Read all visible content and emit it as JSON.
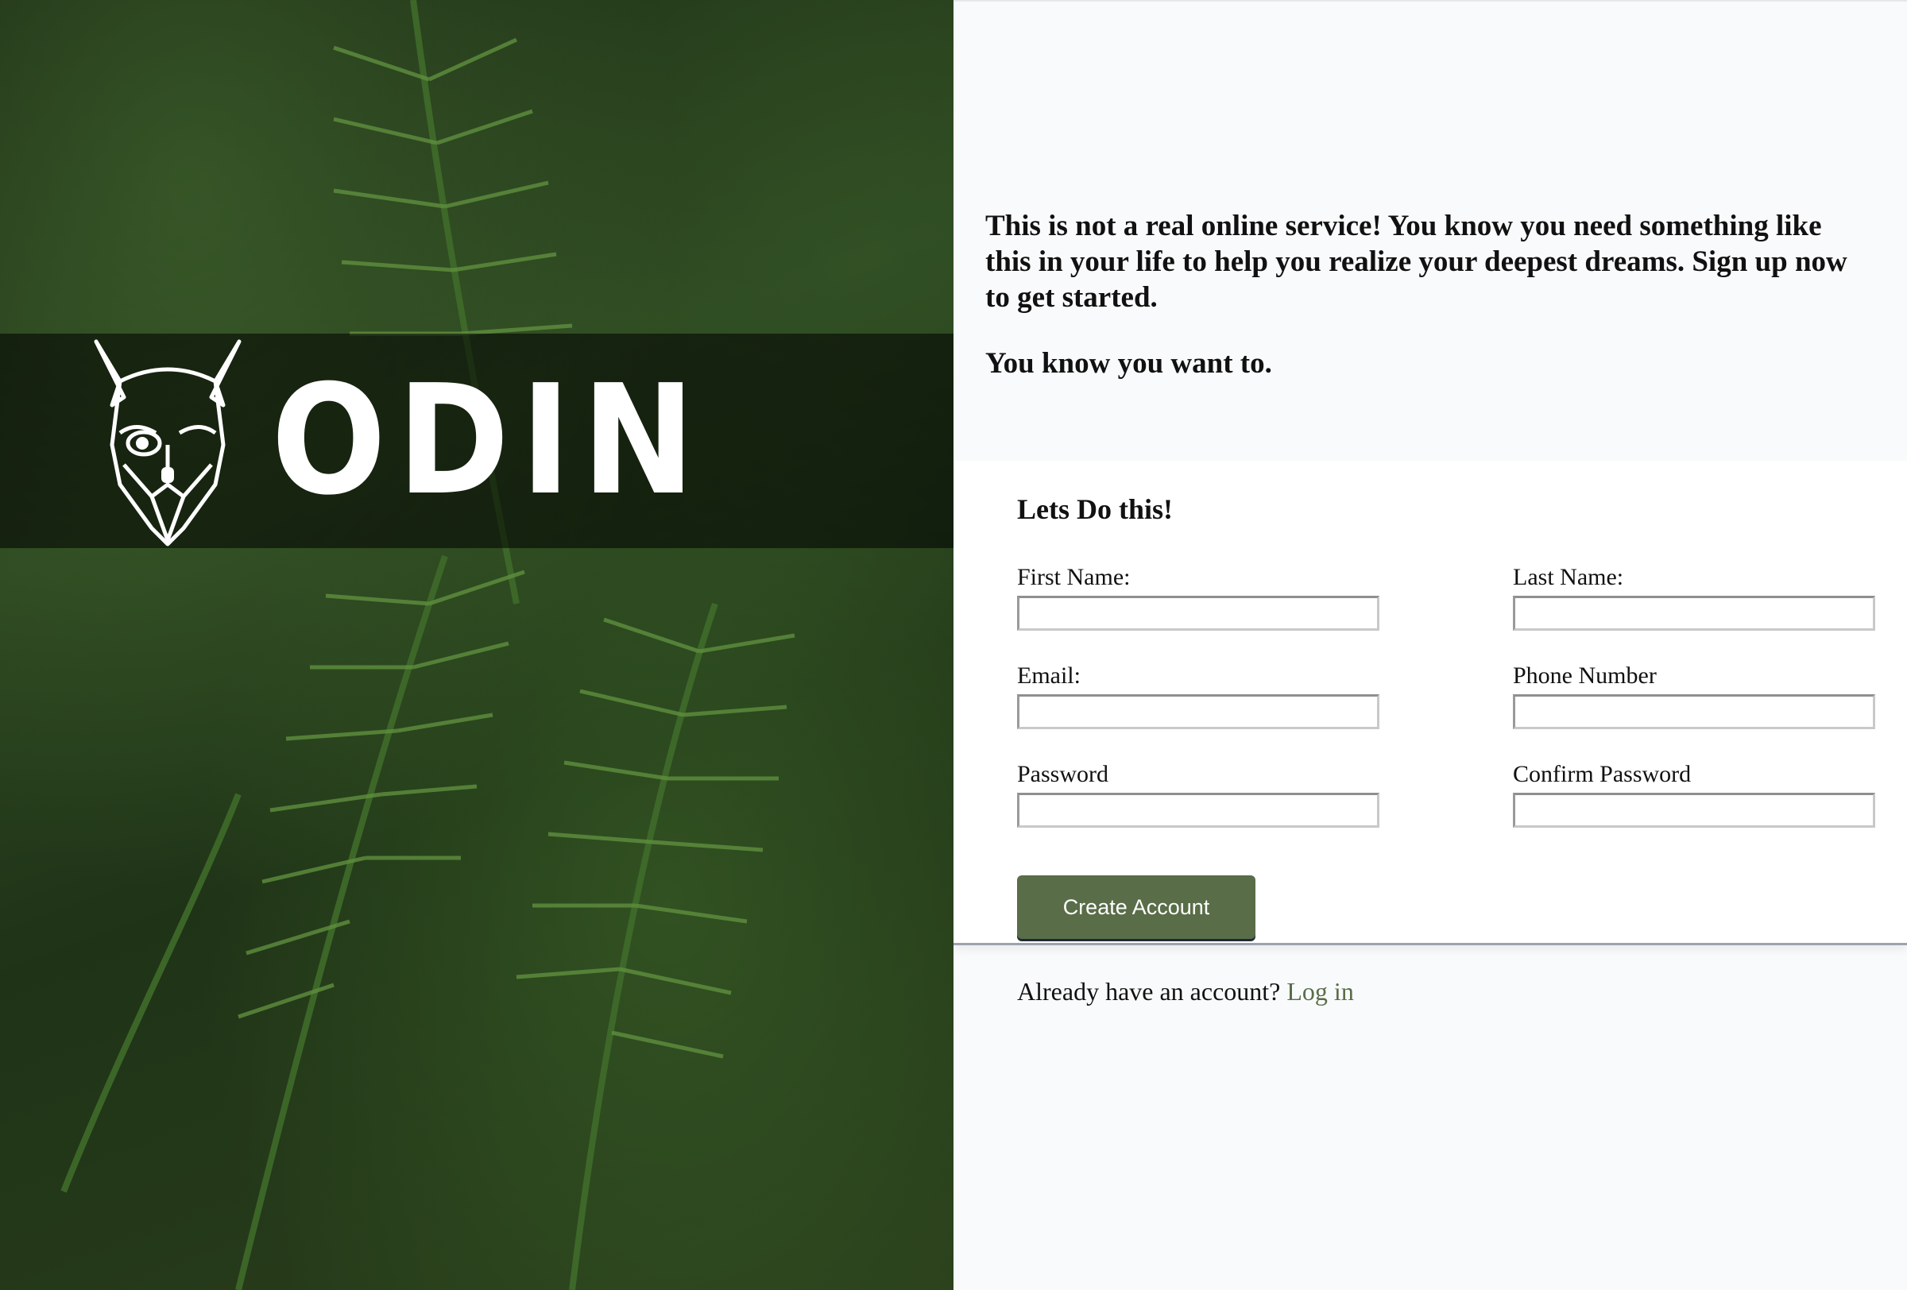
{
  "hero": {
    "logo_text": "ODIN",
    "logo_icon": "viking-head-icon"
  },
  "intro": {
    "paragraph1": "This is not a real online service! You know you need something like this in your life to help you realize your deepest dreams. Sign up now to get started.",
    "paragraph2": "You know you want to."
  },
  "form": {
    "title": "Lets Do this!",
    "fields": {
      "first_name": {
        "label": "First Name:",
        "value": ""
      },
      "last_name": {
        "label": "Last Name:",
        "value": ""
      },
      "email": {
        "label": "Email:",
        "value": ""
      },
      "phone": {
        "label": "Phone Number",
        "value": ""
      },
      "password": {
        "label": "Password",
        "value": ""
      },
      "confirm_password": {
        "label": "Confirm Password",
        "value": ""
      }
    },
    "submit_label": "Create Account"
  },
  "login": {
    "prompt": "Already have an account?",
    "link_label": "Log in"
  },
  "colors": {
    "accent": "#596d48",
    "page_background": "#f9fafb",
    "card_background": "#ffffff"
  }
}
